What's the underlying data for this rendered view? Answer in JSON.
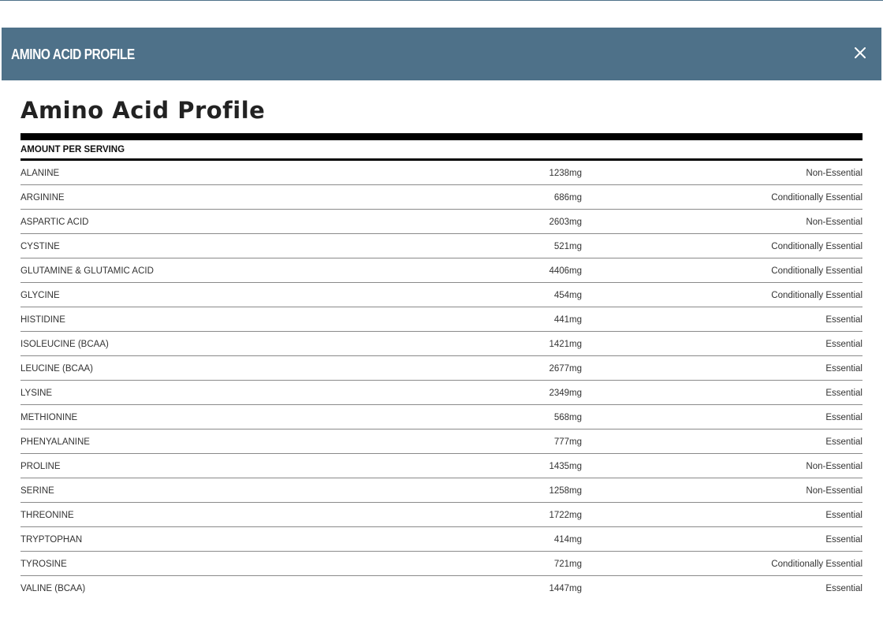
{
  "modal": {
    "header_title": "AMINO ACID PROFILE",
    "close_icon": "close-icon",
    "page_title": "Amino Acid Profile",
    "table_header": "AMOUNT PER SERVING"
  },
  "colors": {
    "header_bg": "#4e7189",
    "rule": "#000000"
  },
  "rows": [
    {
      "name": "ALANINE",
      "amount": "1238mg",
      "type": "Non-Essential"
    },
    {
      "name": "ARGININE",
      "amount": "686mg",
      "type": "Conditionally Essential"
    },
    {
      "name": "ASPARTIC ACID",
      "amount": "2603mg",
      "type": "Non-Essential"
    },
    {
      "name": "CYSTINE",
      "amount": "521mg",
      "type": "Conditionally Essential"
    },
    {
      "name": "GLUTAMINE & GLUTAMIC ACID",
      "amount": "4406mg",
      "type": "Conditionally Essential"
    },
    {
      "name": "GLYCINE",
      "amount": "454mg",
      "type": "Conditionally Essential"
    },
    {
      "name": "HISTIDINE",
      "amount": "441mg",
      "type": "Essential"
    },
    {
      "name": "ISOLEUCINE (BCAA)",
      "amount": "1421mg",
      "type": "Essential"
    },
    {
      "name": "LEUCINE (BCAA)",
      "amount": "2677mg",
      "type": "Essential"
    },
    {
      "name": "LYSINE",
      "amount": "2349mg",
      "type": "Essential"
    },
    {
      "name": "METHIONINE",
      "amount": "568mg",
      "type": "Essential"
    },
    {
      "name": "PHENYALANINE",
      "amount": "777mg",
      "type": "Essential"
    },
    {
      "name": "PROLINE",
      "amount": "1435mg",
      "type": "Non-Essential"
    },
    {
      "name": "SERINE",
      "amount": "1258mg",
      "type": "Non-Essential"
    },
    {
      "name": "THREONINE",
      "amount": "1722mg",
      "type": "Essential"
    },
    {
      "name": "TRYPTOPHAN",
      "amount": "414mg",
      "type": "Essential"
    },
    {
      "name": "TYROSINE",
      "amount": "721mg",
      "type": "Conditionally Essential"
    },
    {
      "name": "VALINE (BCAA)",
      "amount": "1447mg",
      "type": "Essential"
    }
  ]
}
